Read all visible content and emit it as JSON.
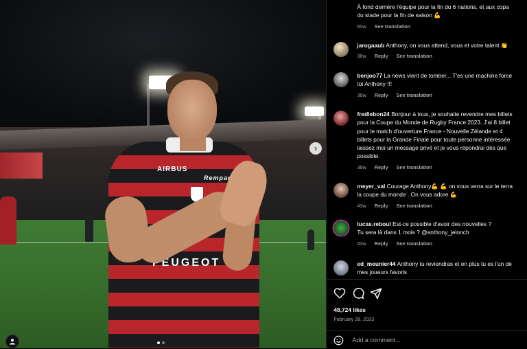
{
  "post": {
    "sponsors": {
      "main": "PEUGEOT",
      "sleeve": "AIRBUS",
      "chest": "Rempart"
    },
    "carousel": {
      "slide_count": 2,
      "active_index": 0
    }
  },
  "comments": [
    {
      "username": "",
      "lines": [
        "À fond derrière l'équipe pour la fin du 6 nations, et aux copa",
        "du stade pour la fin de saison 💪"
      ],
      "age": "60w",
      "reply_label": "",
      "translation_label": "See translation"
    },
    {
      "username": "jarogaaub",
      "lines": [
        "Anthony, on vous attend, vous et votre talent 👏"
      ],
      "age": "36w",
      "reply_label": "Reply",
      "translation_label": "See translation"
    },
    {
      "username": "benjoo77",
      "lines": [
        "La news vient de tomber... T'es une machine force",
        "toi Anthony !!!"
      ],
      "age": "36w",
      "reply_label": "Reply",
      "translation_label": "See translation"
    },
    {
      "username": "fredlebon24",
      "lines": [
        "Bonjour à tous, je souhaite revendre mes billets",
        "pour la Coupe du Monde de Rugby France 2023. J'ai 8 billet",
        "pour le match d'ouverture France - Nouvelle Zélande et 4",
        "billets pour la Grande Finale pour toute personne intéressée",
        "laissez moi un message privé et je vous répondrai dès que",
        "possible."
      ],
      "age": "38w",
      "reply_label": "Reply",
      "translation_label": "See translation"
    },
    {
      "username": "meyer_val",
      "lines": [
        "Courage Anthony💪 💪 on vous verra sur le terra",
        "la coupe du monde . On vous adore 💪"
      ],
      "age": "43w",
      "reply_label": "Reply",
      "translation_label": "See translation"
    },
    {
      "username": "lucas.reboul",
      "lines": [
        "Est-ce possible d'avoir des nouvelles ?",
        "Tu sera là dans 1 mois ? @anthony_jelonch"
      ],
      "age": "43w",
      "reply_label": "Reply",
      "translation_label": "See translation"
    },
    {
      "username": "ed_meunier44",
      "lines": [
        "Anthony tu reviendras et en plus tu es l'un de",
        "mes joueurs favoris"
      ],
      "age": "",
      "reply_label": "",
      "translation_label": ""
    }
  ],
  "actions": {
    "icons": [
      "heart-icon",
      "comment-icon",
      "share-icon"
    ],
    "likes": "48,724 likes",
    "date": "February 28, 2023"
  },
  "add_comment": {
    "placeholder": "Add a comment..."
  },
  "colors": {
    "background": "#000000",
    "text": "#f5f5f5",
    "muted": "#a8a8a8",
    "divider": "#262626",
    "jersey_red": "#b8262c"
  }
}
